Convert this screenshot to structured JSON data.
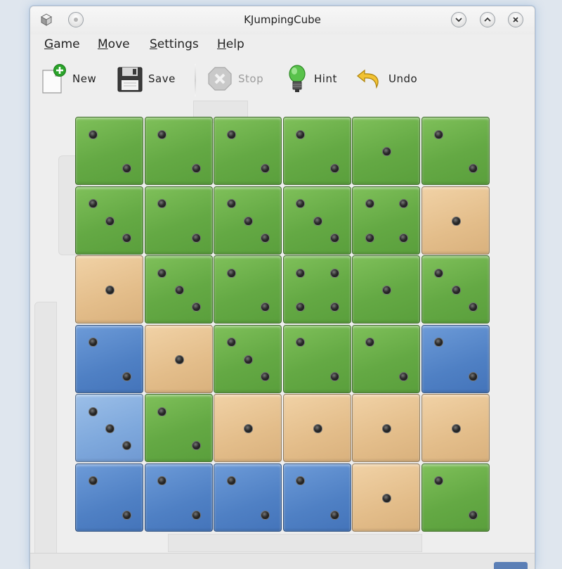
{
  "window": {
    "title": "KJumpingCube"
  },
  "menubar": {
    "items": [
      {
        "label": "Game",
        "mnemonic": "G",
        "rest": "ame"
      },
      {
        "label": "Move",
        "mnemonic": "M",
        "rest": "ove"
      },
      {
        "label": "Settings",
        "mnemonic": "S",
        "rest": "ettings"
      },
      {
        "label": "Help",
        "mnemonic": "H",
        "rest": "elp"
      }
    ]
  },
  "toolbar": {
    "new_label": "New",
    "save_label": "Save",
    "stop_label": "Stop",
    "hint_label": "Hint",
    "undo_label": "Undo"
  },
  "board": {
    "rows": 6,
    "cols": 6,
    "colors": {
      "green": "#64a944",
      "tan": "#e3bd8a",
      "blue": "#4f80c4",
      "lightblue": "#7ea8dc"
    },
    "cells": [
      [
        "green",
        2
      ],
      [
        "green",
        2
      ],
      [
        "green",
        2
      ],
      [
        "green",
        2
      ],
      [
        "green",
        1
      ],
      [
        "green",
        2
      ],
      [
        "green",
        3
      ],
      [
        "green",
        2
      ],
      [
        "green",
        3
      ],
      [
        "green",
        3
      ],
      [
        "green",
        4
      ],
      [
        "tan",
        1
      ],
      [
        "tan",
        1
      ],
      [
        "green",
        3
      ],
      [
        "green",
        2
      ],
      [
        "green",
        4
      ],
      [
        "green",
        1
      ],
      [
        "green",
        3
      ],
      [
        "blue",
        2
      ],
      [
        "tan",
        1
      ],
      [
        "green",
        3
      ],
      [
        "green",
        2
      ],
      [
        "green",
        2
      ],
      [
        "blue",
        2
      ],
      [
        "lightblue",
        3
      ],
      [
        "green",
        2
      ],
      [
        "tan",
        1
      ],
      [
        "tan",
        1
      ],
      [
        "tan",
        1
      ],
      [
        "tan",
        1
      ],
      [
        "blue",
        2
      ],
      [
        "blue",
        2
      ],
      [
        "blue",
        2
      ],
      [
        "blue",
        2
      ],
      [
        "tan",
        1
      ],
      [
        "green",
        2
      ]
    ]
  }
}
